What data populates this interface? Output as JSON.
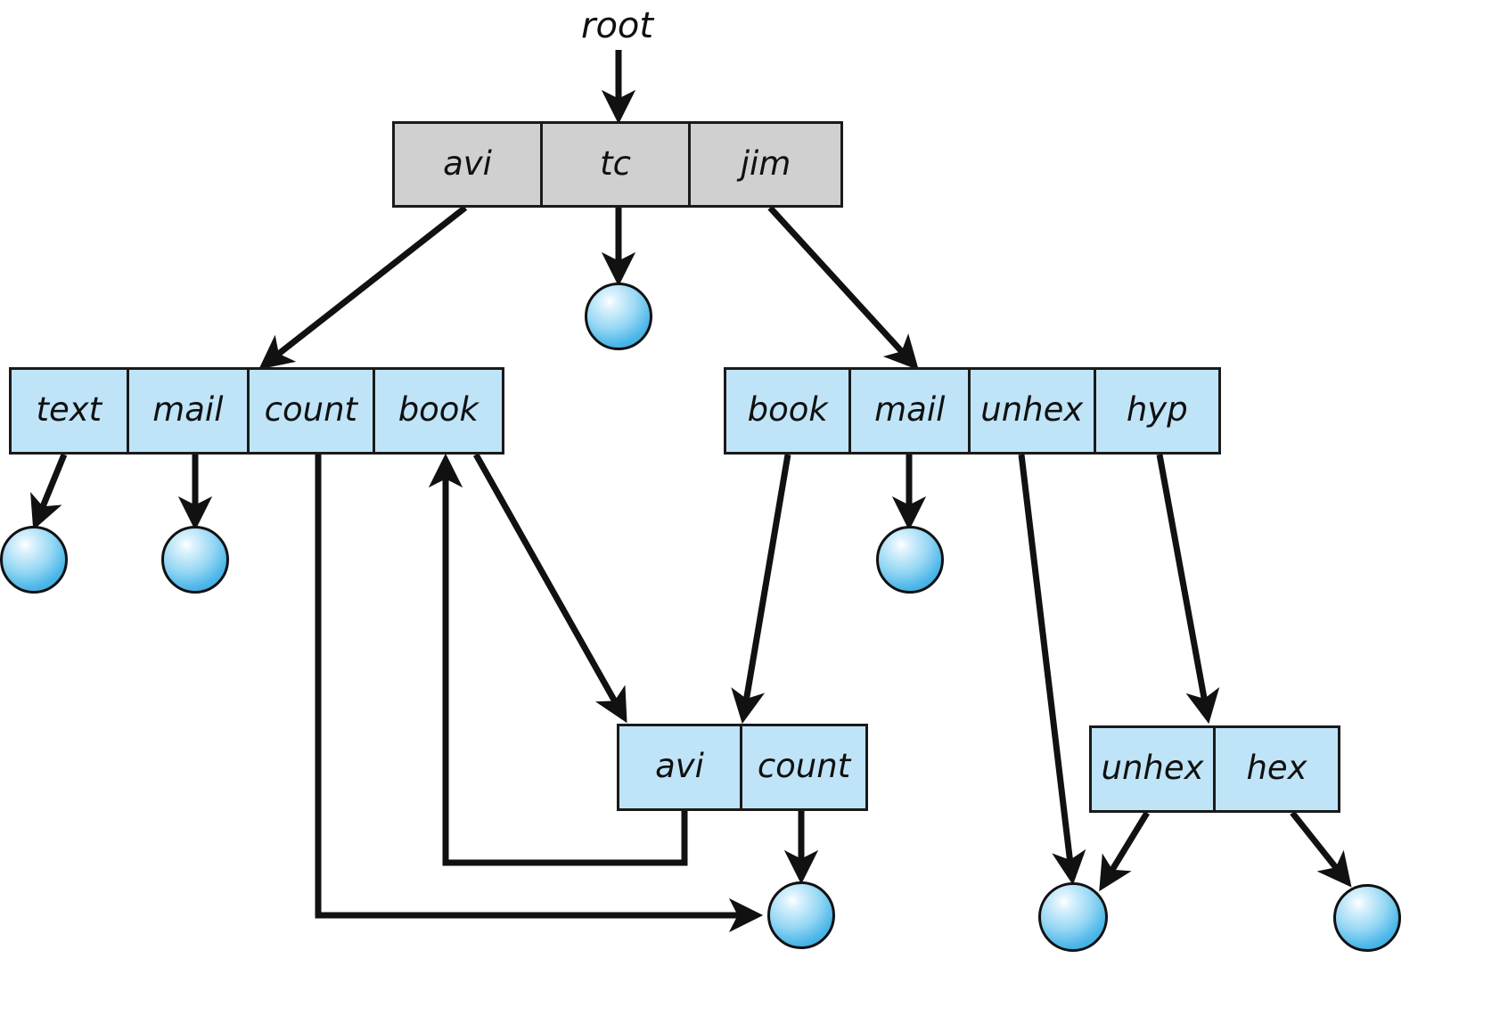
{
  "diagram": {
    "title_label": "root",
    "colors": {
      "root_node_fill": "#d0d0d0",
      "dir_node_fill": "#bfe4f8",
      "sphere_fill": "#6ec6ee",
      "stroke": "#1a1a1a",
      "background": "#ffffff"
    },
    "nodes": [
      {
        "id": "root-dir",
        "kind": "root-directory",
        "entries": [
          {
            "label": "avi"
          },
          {
            "label": "tc"
          },
          {
            "label": "jim"
          }
        ]
      },
      {
        "id": "avi-dir",
        "kind": "directory",
        "entries": [
          {
            "label": "text"
          },
          {
            "label": "mail"
          },
          {
            "label": "count"
          },
          {
            "label": "book"
          }
        ]
      },
      {
        "id": "jim-dir",
        "kind": "directory",
        "entries": [
          {
            "label": "book"
          },
          {
            "label": "mail"
          },
          {
            "label": "unhex"
          },
          {
            "label": "hyp"
          }
        ]
      },
      {
        "id": "book-dir",
        "kind": "directory",
        "entries": [
          {
            "label": "avi"
          },
          {
            "label": "count"
          }
        ]
      },
      {
        "id": "hyp-dir",
        "kind": "directory",
        "entries": [
          {
            "label": "unhex"
          },
          {
            "label": "hex"
          }
        ]
      }
    ],
    "file_blobs": [
      {
        "id": "blob-tc"
      },
      {
        "id": "blob-text"
      },
      {
        "id": "blob-mail-avi"
      },
      {
        "id": "blob-mail-jim"
      },
      {
        "id": "blob-count"
      },
      {
        "id": "blob-unhex"
      },
      {
        "id": "blob-hex"
      }
    ],
    "edges": [
      {
        "from": "root-label",
        "to": "root-dir.tc",
        "style": "straight"
      },
      {
        "from": "root-dir.avi",
        "to": "avi-dir",
        "style": "straight"
      },
      {
        "from": "root-dir.tc",
        "to": "blob-tc",
        "style": "straight"
      },
      {
        "from": "root-dir.jim",
        "to": "jim-dir",
        "style": "straight"
      },
      {
        "from": "avi-dir.text",
        "to": "blob-text",
        "style": "straight"
      },
      {
        "from": "avi-dir.mail",
        "to": "blob-mail-avi",
        "style": "straight"
      },
      {
        "from": "avi-dir.book",
        "to": "book-dir",
        "style": "straight"
      },
      {
        "from": "avi-dir.count",
        "to": "blob-count",
        "style": "orthogonal"
      },
      {
        "from": "book-dir.avi",
        "to": "avi-dir.book",
        "style": "orthogonal"
      },
      {
        "from": "book-dir.count",
        "to": "blob-count",
        "style": "straight"
      },
      {
        "from": "jim-dir.book",
        "to": "book-dir",
        "style": "straight"
      },
      {
        "from": "jim-dir.mail",
        "to": "blob-mail-jim",
        "style": "straight"
      },
      {
        "from": "jim-dir.unhex",
        "to": "blob-unhex",
        "style": "straight"
      },
      {
        "from": "jim-dir.hyp",
        "to": "hyp-dir",
        "style": "straight"
      },
      {
        "from": "hyp-dir.unhex",
        "to": "blob-unhex",
        "style": "straight"
      },
      {
        "from": "hyp-dir.hex",
        "to": "blob-hex",
        "style": "straight"
      }
    ]
  }
}
